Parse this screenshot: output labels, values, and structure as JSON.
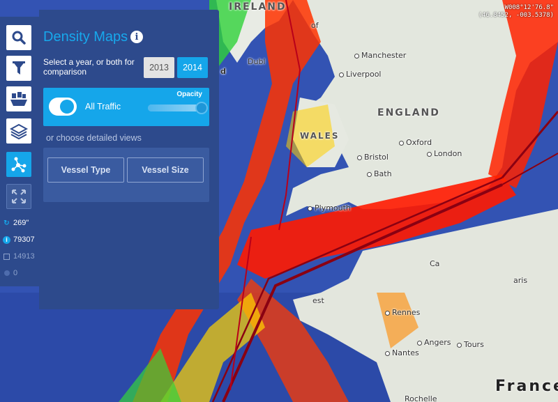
{
  "map": {
    "labels": {
      "ireland": "IRELAND",
      "england": "ENGLAND",
      "wales": "WALES",
      "france": "France",
      "manchester": "Manchester",
      "liverpool": "Liverpool",
      "dublin": "Dubl",
      "oxford": "Oxford",
      "london": "London",
      "bristol": "Bristol",
      "bath": "Bath",
      "plymouth": "Plymouth",
      "rennes": "Rennes",
      "nantes": "Nantes",
      "angers": "Angers",
      "tours": "Tours",
      "rochelle": "Rochelle",
      "paris": "aris",
      "brest": "est",
      "caen": "Ca",
      "york": "of",
      "dublin_d": "d"
    },
    "coordinates": {
      "line1": "W008°12'76.8\"",
      "line2": "(46.8452, -003.5378)"
    }
  },
  "toolbar": {
    "buttons": [
      {
        "name": "search",
        "icon": "search-icon"
      },
      {
        "name": "filter",
        "icon": "funnel-icon"
      },
      {
        "name": "fleet",
        "icon": "fleet-icon"
      },
      {
        "name": "layers",
        "icon": "layers-icon"
      },
      {
        "name": "density",
        "icon": "network-icon"
      },
      {
        "name": "fullscreen",
        "icon": "expand-icon"
      }
    ],
    "stats": {
      "refresh": "269\"",
      "info": "79307",
      "square": "14913",
      "dot": "0"
    }
  },
  "panel": {
    "title": "Density Maps",
    "description": "Select a year, or both for comparison",
    "years": [
      "2013",
      "2014"
    ],
    "selected_year": "2014",
    "traffic_label": "All Traffic",
    "traffic_on": true,
    "opacity_label": "Opacity",
    "opacity_value": 1.0,
    "detail_label": "or choose detailed views",
    "vessel_type_label": "Vessel Type",
    "vessel_size_label": "Vessel Size"
  },
  "colors": {
    "panel_bg": "#2d4a8c",
    "accent": "#15a6ea",
    "heat_high": "#e60000",
    "heat_mid": "#ffcc00",
    "heat_low": "#39d639",
    "sea": "#3353b3"
  }
}
